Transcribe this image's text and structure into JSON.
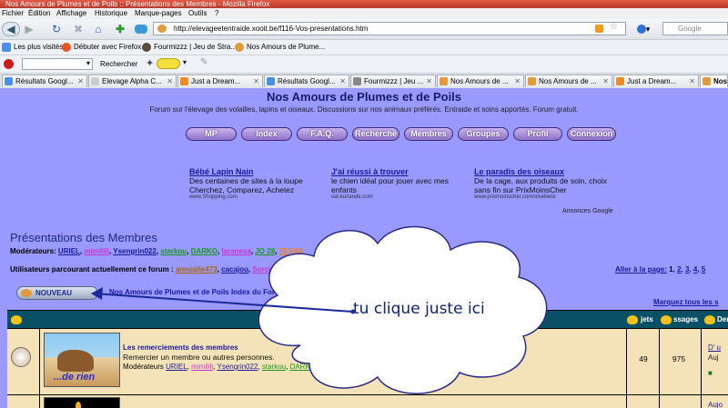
{
  "window": {
    "title": "Nos Amours de Plumes et de Poils :: Présentations des Membres - Mozilla Firefox"
  },
  "menubar": [
    "Fichier",
    "Édition",
    "Affichage",
    "Historique",
    "Marque-pages",
    "Outils",
    "?"
  ],
  "nav": {
    "url": "http://elevageetentraide.xooit.be/f116-Vos-presentations.htm",
    "search_placeholder": "Google"
  },
  "bookmarks": [
    "Les plus visités",
    "Débuter avec Firefox",
    "Fourmizzz | Jeu de Stra...",
    "Nos Amours de Plume..."
  ],
  "toolbar2": {
    "search_label": "Rechercher"
  },
  "tabs": [
    {
      "label": "Résultats Googl...",
      "color": "#4a8fe8"
    },
    {
      "label": "Elevage Alpha C...",
      "color": "#cccccc"
    },
    {
      "label": "Just a Dream...",
      "color": "#f08a24"
    },
    {
      "label": "Résultats Googl...",
      "color": "#4a8fe8"
    },
    {
      "label": "Fourmizzz | Jeu ...",
      "color": "#888888"
    },
    {
      "label": "Nos Amours de ...",
      "color": "#e39a3a"
    },
    {
      "label": "Nos Amours de ...",
      "color": "#e39a3a"
    },
    {
      "label": "Just a Dream...",
      "color": "#f08a24"
    },
    {
      "label": "Nos",
      "color": "#e39a3a"
    }
  ],
  "site": {
    "title": "Nos Amours de Plumes et de Poils",
    "tagline": "Forum sur l'élevage des volailles, lapins et oiseaux. Discussions sur nos animaux préférés. Entraide et soins apportés. Forum gratuit.",
    "nav_buttons": [
      "MP",
      "Index",
      "F.A.Q.",
      "Recherche",
      "Membres",
      "Groupes",
      "Profil",
      "Connexion"
    ]
  },
  "ads": [
    {
      "title": "Bébé Lapin Nain",
      "desc": "Des centaines de sites à la loupe Cherchez, Comparez, Achetez",
      "url": "www.Shopping.com"
    },
    {
      "title": "J'ai réussi à trouver",
      "desc": "le chien idéal pour jouer avec mes enfants",
      "url": "val-kurlande.com"
    },
    {
      "title": "Le paradis des oiseaux",
      "desc": "De la cage, aux produits de soin, choix sans fin sur PrixMoinsCher",
      "url": "www.prixmoinscher.com/oisellerie"
    }
  ],
  "ads_label": "Annonces Google",
  "forum": {
    "section_title": "Présentations des Membres",
    "moderators_label": "Modérateurs:",
    "moderators": [
      {
        "name": "URIEL",
        "color": "#1a1aa0"
      },
      {
        "name": "mimilili",
        "color": "#cc33cc"
      },
      {
        "name": "Ysengrin022",
        "color": "#1a1aa0"
      },
      {
        "name": "starkou",
        "color": "#1a9a1a"
      },
      {
        "name": "DARKO",
        "color": "#1a9a1a"
      },
      {
        "name": "laranesa",
        "color": "#cc33cc"
      },
      {
        "name": "JO 28",
        "color": "#1a9a1a"
      },
      {
        "name": "TEXAS",
        "color": "#ff7f00"
      }
    ],
    "users_label": "Utilisateurs parcourant actuellement ce forum :",
    "users": [
      {
        "name": "annoalle473",
        "color": "#aa6600"
      },
      {
        "name": "cacajou",
        "color": "#1a1aa0"
      },
      {
        "name": "Sorcière",
        "color": "#cc33cc"
      }
    ],
    "goto_page_label": "Aller à la page:",
    "pages": [
      "1",
      "2",
      "3",
      "4",
      "5"
    ],
    "new_button": "NOUVEAU",
    "breadcrumb": "Nos Amours de Plumes et de Poils Index du Forum ->",
    "mark_all": "Marquez tous les s",
    "table_headers": {
      "forum": "Fo",
      "subjects": "jets",
      "messages": "ssages",
      "lastpost": "Der"
    },
    "rows": [
      {
        "name": "Les remerciements des membres",
        "desc": "Remercier un membre ou autres personnes.",
        "mods_label": "Modérateurs",
        "mods": [
          {
            "name": "URIEL",
            "color": "#1a1aa0"
          },
          {
            "name": "mimilili",
            "color": "#cc33cc"
          },
          {
            "name": "Ysengrin022",
            "color": "#1a1aa0"
          },
          {
            "name": "starkou",
            "color": "#1a9a1a"
          },
          {
            "name": "DARK",
            "color": "#1a9a1a"
          }
        ],
        "thumb_caption": "...de rien",
        "subjects": "49",
        "messages": "975",
        "lastpost": [
          "D' u",
          "Auj"
        ]
      },
      {
        "lastpost": [
          "Aujo"
        ]
      }
    ]
  },
  "annotation": {
    "text": "tu clique juste ici"
  }
}
